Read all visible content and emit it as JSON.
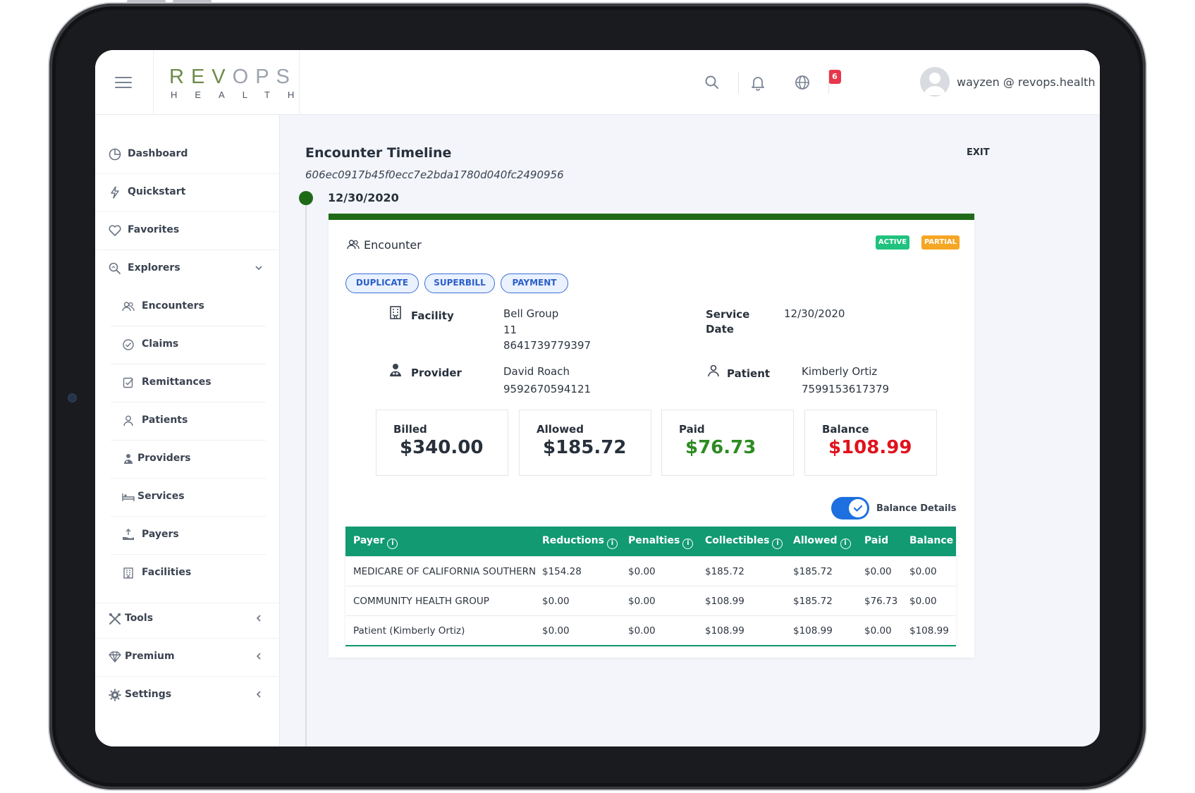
{
  "header": {
    "logo_top_a": "REV",
    "logo_top_b": "OPS",
    "logo_bottom": "HEALTH",
    "notification_count": "6",
    "user_name": "wayzen @ revops.health"
  },
  "sidebar": {
    "items": [
      {
        "label": "Dashboard",
        "icon": "pie-chart-icon"
      },
      {
        "label": "Quickstart",
        "icon": "lightning-icon"
      },
      {
        "label": "Favorites",
        "icon": "heart-icon"
      },
      {
        "label": "Explorers",
        "icon": "search-analytics-icon"
      }
    ],
    "explorers": [
      {
        "label": "Encounters",
        "icon": "users-icon"
      },
      {
        "label": "Claims",
        "icon": "check-circle-icon"
      },
      {
        "label": "Remittances",
        "icon": "checked-doc-icon"
      },
      {
        "label": "Patients",
        "icon": "user-icon"
      },
      {
        "label": "Providers",
        "icon": "doctor-icon"
      },
      {
        "label": "Services",
        "icon": "bed-icon"
      },
      {
        "label": "Payers",
        "icon": "hand-money-icon"
      },
      {
        "label": "Facilities",
        "icon": "building-icon"
      }
    ],
    "bottom": [
      {
        "label": "Tools",
        "icon": "tools-icon"
      },
      {
        "label": "Premium",
        "icon": "diamond-icon"
      },
      {
        "label": "Settings",
        "icon": "gear-icon"
      }
    ]
  },
  "page": {
    "title": "Encounter Timeline",
    "id": "606ec0917b45f0ecc7e2bda1780d040fc2490956",
    "exit_label": "EXIT",
    "timeline_date": "12/30/2020"
  },
  "encounter": {
    "title": "Encounter",
    "badges": {
      "active": "ACTIVE",
      "partial": "PARTIAL"
    },
    "actions": {
      "duplicate": "DUPLICATE",
      "superbill": "SUPERBILL",
      "payment": "PAYMENT"
    },
    "facility": {
      "label": "Facility",
      "name": "Bell Group",
      "line2": "11",
      "line3": "8641739779397"
    },
    "service_date": {
      "label_line1": "Service",
      "label_line2": "Date",
      "value": "12/30/2020"
    },
    "provider": {
      "label": "Provider",
      "name": "David Roach",
      "id": "9592670594121"
    },
    "patient": {
      "label": "Patient",
      "name": "Kimberly Ortiz",
      "id": "7599153617379"
    },
    "stats": {
      "billed": {
        "label": "Billed",
        "value": "$340.00"
      },
      "allowed": {
        "label": "Allowed",
        "value": "$185.72"
      },
      "paid": {
        "label": "Paid",
        "value": "$76.73"
      },
      "balance": {
        "label": "Balance",
        "value": "$108.99"
      }
    },
    "balance_toggle_label": "Balance Details",
    "balance_toggle_on": true
  },
  "table": {
    "headers": {
      "payer": "Payer",
      "reductions": "Reductions",
      "penalties": "Penalties",
      "collectibles": "Collectibles",
      "allowed": "Allowed",
      "paid": "Paid",
      "balance": "Balance"
    },
    "info_glyph": "i",
    "rows": [
      {
        "payer": "MEDICARE OF CALIFORNIA SOUTHERN",
        "reductions": "$154.28",
        "penalties": "$0.00",
        "collectibles": "$185.72",
        "allowed": "$185.72",
        "paid": "$0.00",
        "balance": "$0.00"
      },
      {
        "payer": "COMMUNITY HEALTH GROUP",
        "reductions": "$0.00",
        "penalties": "$0.00",
        "collectibles": "$108.99",
        "allowed": "$185.72",
        "paid": "$76.73",
        "balance": "$0.00"
      },
      {
        "payer": "Patient (Kimberly Ortiz)",
        "reductions": "$0.00",
        "penalties": "$0.00",
        "collectibles": "$108.99",
        "allowed": "$108.99",
        "paid": "$0.00",
        "balance": "$108.99"
      }
    ]
  },
  "colors": {
    "accent_green": "#1f6a18",
    "table_header": "#129a72",
    "paid_green": "#2e8b22",
    "balance_red": "#e0131c",
    "badge_active": "#1fc27e",
    "badge_partial": "#f5a623",
    "pill_blue": "#2a5fc8"
  }
}
